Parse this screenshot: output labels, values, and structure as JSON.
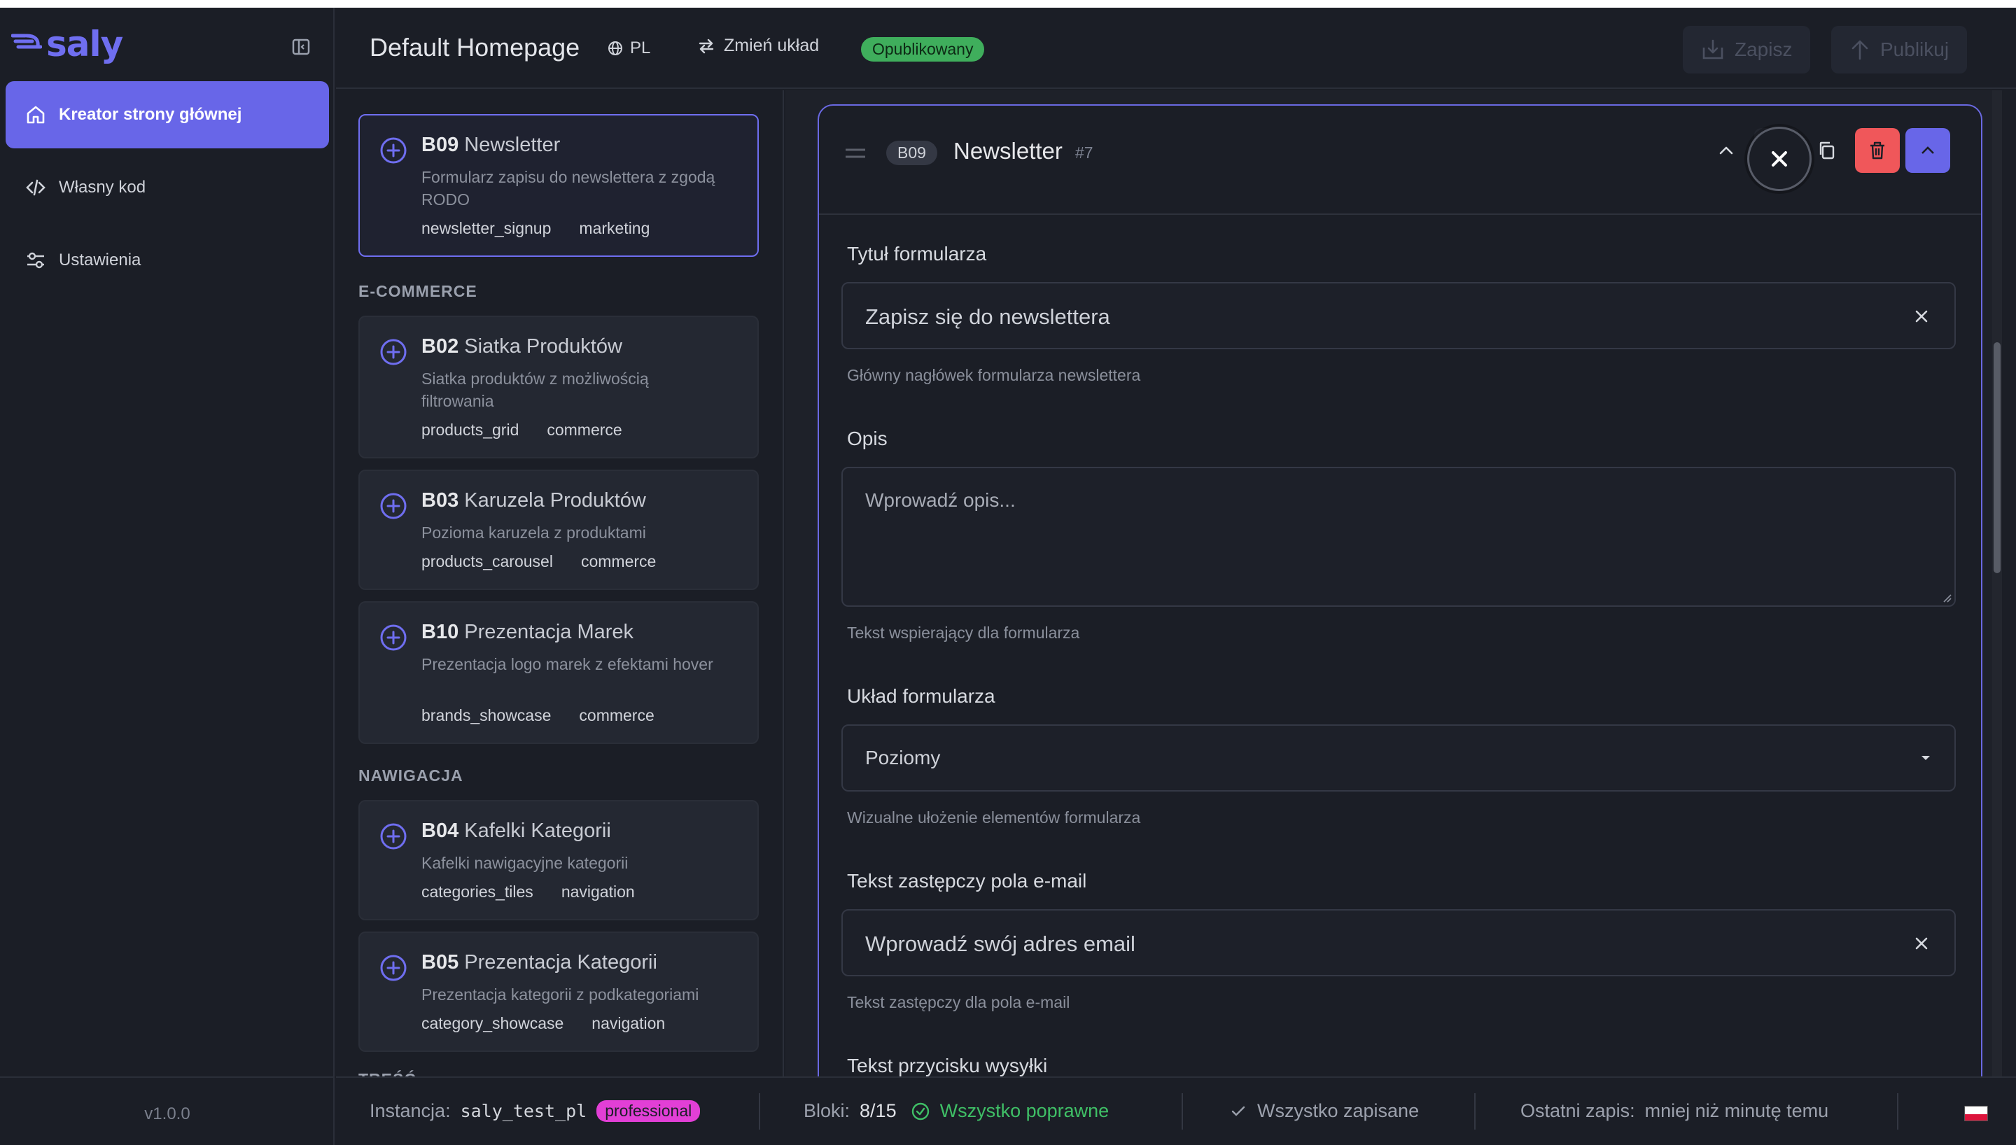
{
  "sidebar": {
    "logo": "saly",
    "items": [
      {
        "label": "Kreator strony głównej",
        "icon": "home-icon"
      },
      {
        "label": "Własny kod",
        "icon": "code-icon"
      },
      {
        "label": "Ustawienia",
        "icon": "sliders-icon"
      }
    ],
    "version": "v1.0.0"
  },
  "topbar": {
    "title": "Default Homepage",
    "language": "PL",
    "change_layout": "Zmień układ",
    "status": "Opublikowany",
    "save": "Zapisz",
    "publish": "Publikuj"
  },
  "catalog": {
    "top_card": {
      "code": "B09",
      "name": "Newsletter",
      "description": "Formularz zapisu do newslettera z zgodą RODO",
      "tags": [
        "newsletter_signup",
        "marketing"
      ]
    },
    "sections": [
      {
        "title": "E-COMMERCE"
      },
      {
        "title": "NAWIGACJA"
      },
      {
        "title": "TREŚĆ"
      }
    ],
    "cards": [
      {
        "code": "B02",
        "name": "Siatka Produktów",
        "description": "Siatka produktów z możliwością filtrowania",
        "tags": [
          "products_grid",
          "commerce"
        ]
      },
      {
        "code": "B03",
        "name": "Karuzela Produktów",
        "description": "Pozioma karuzela z produktami",
        "tags": [
          "products_carousel",
          "commerce"
        ]
      },
      {
        "code": "B10",
        "name": "Prezentacja Marek",
        "description": "Prezentacja logo marek z efektami hover",
        "tags": [
          "brands_showcase",
          "commerce"
        ]
      },
      {
        "code": "B04",
        "name": "Kafelki Kategorii",
        "description": "Kafelki nawigacyjne kategorii",
        "tags": [
          "categories_tiles",
          "navigation"
        ]
      },
      {
        "code": "B05",
        "name": "Prezentacja Kategorii",
        "description": "Prezentacja kategorii z podkategoriami",
        "tags": [
          "category_showcase",
          "navigation"
        ]
      }
    ]
  },
  "editor": {
    "code": "B09",
    "title": "Newsletter",
    "number": "#7",
    "fields": {
      "form_title": {
        "label": "Tytuł formularza",
        "value": "Zapisz się do newslettera",
        "help": "Główny nagłówek formularza newslettera"
      },
      "description": {
        "label": "Opis",
        "placeholder": "Wprowadź opis...",
        "help": "Tekst wspierający dla formularza"
      },
      "layout": {
        "label": "Układ formularza",
        "value": "Poziomy",
        "help": "Wizualne ułożenie elementów formularza"
      },
      "email_placeholder": {
        "label": "Tekst zastępczy pola e-mail",
        "value": "Wprowadź swój adres email",
        "help": "Tekst zastępczy dla pola e-mail"
      },
      "submit_text": {
        "label": "Tekst przycisku wysyłki"
      }
    }
  },
  "footer": {
    "instance_label": "Instancja:",
    "instance_value": "saly_test_pl",
    "plan": "professional",
    "blocks_label": "Bloki:",
    "blocks_value": "8/15",
    "valid": "Wszystko poprawne",
    "saved": "Wszystko zapisane",
    "last_save_label": "Ostatni zapis:",
    "last_save_value": "mniej niż minutę temu"
  },
  "colors": {
    "accent": "#6866e8",
    "published": "#3fae5c",
    "danger": "#f0575a",
    "plan_badge": "#e23fd6",
    "ok": "#3fbf66"
  }
}
